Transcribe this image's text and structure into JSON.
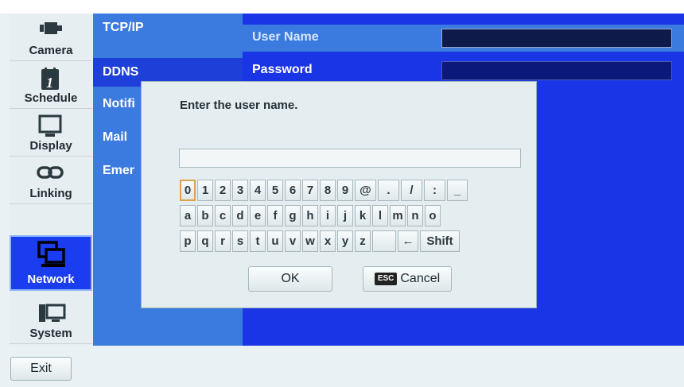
{
  "sidebar": {
    "items": [
      {
        "label": "Camera",
        "icon": "camera-icon"
      },
      {
        "label": "Schedule",
        "icon": "calendar-icon"
      },
      {
        "label": "Display",
        "icon": "monitor-icon"
      },
      {
        "label": "Linking",
        "icon": "link-icon"
      },
      {
        "label": "Network",
        "icon": "network-icon"
      },
      {
        "label": "System",
        "icon": "computer-icon"
      }
    ],
    "selected": "Network"
  },
  "submenu": {
    "items": [
      "TCP/IP",
      "DDNS",
      "Notifi",
      "Mail",
      "Emer"
    ],
    "selected": "DDNS"
  },
  "main": {
    "rows": [
      {
        "label": "User Name"
      },
      {
        "label": "Password"
      }
    ]
  },
  "dialog": {
    "prompt": "Enter the user name.",
    "input_value": "",
    "keyboard": {
      "row1": [
        "0",
        "1",
        "2",
        "3",
        "4",
        "5",
        "6",
        "7",
        "8",
        "9",
        "@",
        ".",
        "/",
        ":",
        "_"
      ],
      "row2": [
        "a",
        "b",
        "c",
        "d",
        "e",
        "f",
        "g",
        "h",
        "i",
        "j",
        "k",
        "l",
        "m",
        "n",
        "o"
      ],
      "row3": [
        "p",
        "q",
        "r",
        "s",
        "t",
        "u",
        "v",
        "w",
        "x",
        "y",
        "z",
        "",
        "←",
        "Shift"
      ]
    },
    "ok_label": "OK",
    "cancel_badge": "ESC",
    "cancel_label": "Cancel"
  },
  "bottom": {
    "exit_label": "Exit"
  },
  "colors": {
    "panel_blue": "#1a35e6",
    "submenu_blue": "#3b7be0",
    "focus_key": "#e0a24a"
  }
}
